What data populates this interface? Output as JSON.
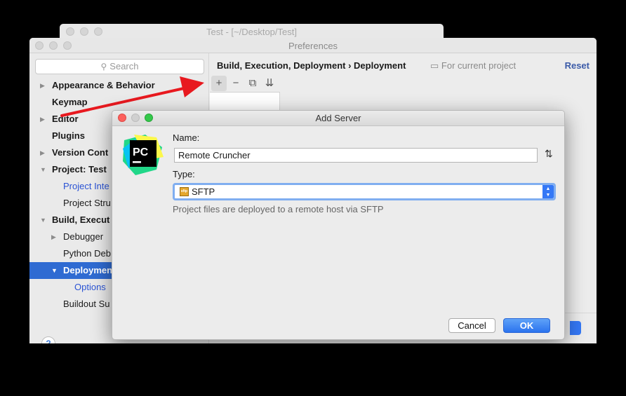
{
  "back_window": {
    "title": "Test - [~/Desktop/Test]"
  },
  "preferences": {
    "title": "Preferences",
    "search_placeholder": "Search",
    "tree": [
      {
        "label": "Appearance & Behavior",
        "bold": true,
        "arrow": "▶"
      },
      {
        "label": "Keymap",
        "bold": true,
        "arrow": ""
      },
      {
        "label": "Editor",
        "bold": true,
        "arrow": "▶"
      },
      {
        "label": "Plugins",
        "bold": true,
        "arrow": ""
      },
      {
        "label": "Version Cont",
        "bold": true,
        "arrow": "▶"
      },
      {
        "label": "Project: Test",
        "bold": true,
        "arrow": "▼"
      },
      {
        "label": "Project Inte",
        "blue": true,
        "arrow": ""
      },
      {
        "label": "Project Stru",
        "arrow": ""
      },
      {
        "label": "Build, Execut",
        "bold": true,
        "arrow": "▼"
      },
      {
        "label": "Debugger",
        "arrow": "▶"
      },
      {
        "label": "Python Deb",
        "arrow": ""
      },
      {
        "label": "Deployment",
        "bold": true,
        "arrow": "▼",
        "selected": true
      },
      {
        "label": "Options",
        "blue": true,
        "arrow": ""
      },
      {
        "label": "Buildout Su",
        "arrow": ""
      }
    ],
    "breadcrumb": "Build, Execution, Deployment › Deployment",
    "scope_label": "For current project",
    "reset_label": "Reset",
    "help_label": "?",
    "toolbar": {
      "add": "+",
      "remove": "−",
      "copy": "⧉",
      "import": "⇊"
    }
  },
  "dialog": {
    "title": "Add Server",
    "name_label": "Name:",
    "name_value": "Remote Cruncher",
    "type_label": "Type:",
    "type_value": "SFTP",
    "type_icon_text": "sftp",
    "description": "Project files are deployed to a remote host via SFTP",
    "logo_text": "PC",
    "swap_icon": "⇅",
    "cancel_label": "Cancel",
    "ok_label": "OK"
  },
  "colors": {
    "selection": "#2f6bd2",
    "ok_button": "#3478f6",
    "arrow": "#e8191f",
    "link_blue": "#2a53d4"
  }
}
